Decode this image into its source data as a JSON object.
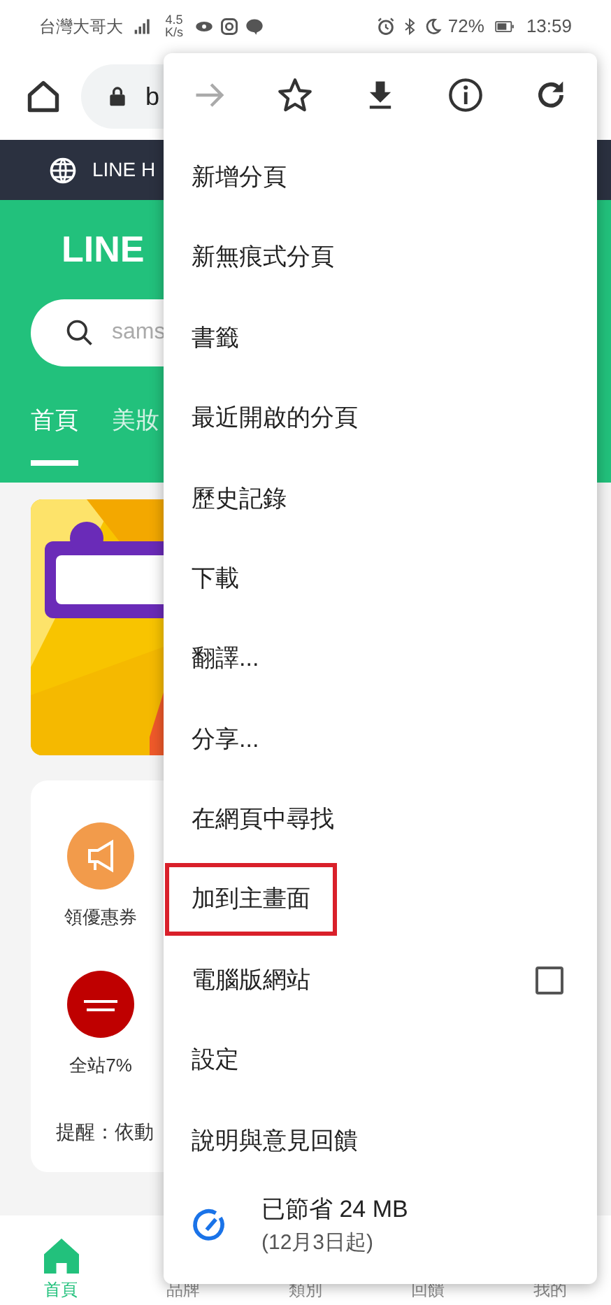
{
  "status_bar": {
    "carrier": "台灣大哥大",
    "speed": "4.5",
    "speed_unit": "K/s",
    "battery": "72%",
    "time": "13:59"
  },
  "browser": {
    "url": "b"
  },
  "site": {
    "top_bar": "LINE H",
    "brand": "LINE",
    "search_placeholder": "sams",
    "tabs": [
      {
        "label": "首頁",
        "selected": true
      },
      {
        "label": "美妝",
        "selected": false
      }
    ],
    "shortcuts": [
      {
        "kind": "coupon",
        "label": "領優惠券"
      },
      {
        "kind": "store",
        "label": "全站7%"
      }
    ],
    "notice": "提醒：依動",
    "bottom_nav": [
      {
        "label": "首頁",
        "selected": true
      },
      {
        "label": "品牌",
        "selected": false
      },
      {
        "label": "類別",
        "selected": false
      },
      {
        "label": "回饋",
        "selected": false
      },
      {
        "label": "我的",
        "selected": false
      }
    ]
  },
  "menu": {
    "toolbar": [
      {
        "kind": "forward",
        "disabled": true
      },
      {
        "kind": "bookmark",
        "disabled": false
      },
      {
        "kind": "download",
        "disabled": false
      },
      {
        "kind": "info",
        "disabled": false
      },
      {
        "kind": "reload",
        "disabled": false
      }
    ],
    "items": [
      {
        "label": "新增分頁",
        "highlighted": false
      },
      {
        "label": "新無痕式分頁",
        "highlighted": false
      },
      {
        "label": "書籤",
        "highlighted": false
      },
      {
        "label": "最近開啟的分頁",
        "highlighted": false
      },
      {
        "label": "歷史記錄",
        "highlighted": false
      },
      {
        "label": "下載",
        "highlighted": false
      },
      {
        "label": "翻譯...",
        "highlighted": false
      },
      {
        "label": "分享...",
        "highlighted": false
      },
      {
        "label": "在網頁中尋找",
        "highlighted": false
      },
      {
        "label": "加到主畫面",
        "highlighted": true
      },
      {
        "label": "電腦版網站",
        "highlighted": false,
        "checked": false
      },
      {
        "label": "設定",
        "highlighted": false
      },
      {
        "label": "說明與意見回饋",
        "highlighted": false
      }
    ],
    "data_saver": {
      "title": "已節省 24 MB",
      "subtitle": "(12月3日起)"
    }
  }
}
